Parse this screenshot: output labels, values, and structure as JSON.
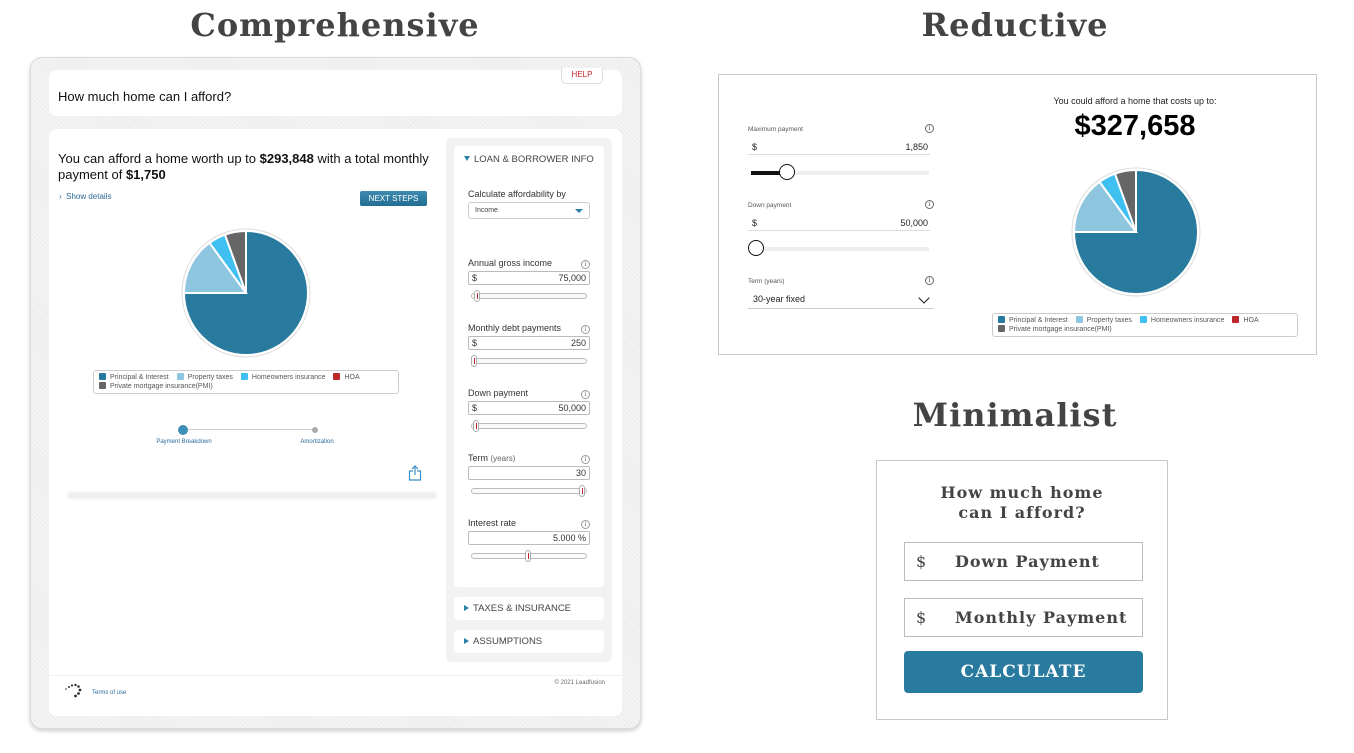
{
  "titles": {
    "comprehensive": "Comprehensive",
    "reductive": "Reductive",
    "minimalist": "Minimalist"
  },
  "colors": {
    "principal": "#287b9e",
    "taxes": "#8ec6e0",
    "homeowners": "#3fc0f0",
    "hoa": "#c0272d",
    "pmi": "#666666",
    "accent": "#287b9e"
  },
  "pie_shares": [
    {
      "key": "principal",
      "percent": 75
    },
    {
      "key": "taxes",
      "percent": 15
    },
    {
      "key": "homeowners",
      "percent": 4.5
    },
    {
      "key": "hoa",
      "percent": 0
    },
    {
      "key": "pmi",
      "percent": 5.5
    }
  ],
  "legend": [
    {
      "key": "principal",
      "label": "Principal & Interest"
    },
    {
      "key": "taxes",
      "label": "Property taxes"
    },
    {
      "key": "homeowners",
      "label": "Homeowners insurance"
    },
    {
      "key": "hoa",
      "label": "HOA"
    },
    {
      "key": "pmi",
      "label": "Private mortgage insurance(PMI)"
    }
  ],
  "comprehensive": {
    "question": "How much home can I afford?",
    "help": "HELP",
    "afford_prefix": "You can afford a home worth up to ",
    "afford_amount": "$293,848",
    "afford_mid": " with a total monthly payment of ",
    "afford_payment": "$1,750",
    "show_details": "Show details",
    "next_steps": "NEXT STEPS",
    "stepper": [
      "Payment Breakdown",
      "Amortization"
    ],
    "terms": "Terms of use",
    "copyright": "© 2021 Leadfusion",
    "side": {
      "loan_header": "LOAN & BORROWER INFO",
      "calc_by_label": "Calculate affordability by",
      "calc_by_value": "Income",
      "fields": [
        {
          "label": "Annual gross income",
          "sub": "",
          "currency": "$",
          "value": "75,000",
          "slider": 0.03
        },
        {
          "label": "Monthly debt payments",
          "sub": "",
          "currency": "$",
          "value": "250",
          "slider": 0.0
        },
        {
          "label": "Down payment",
          "sub": "",
          "currency": "$",
          "value": "50,000",
          "slider": 0.02
        },
        {
          "label": "Term",
          "sub": "(years)",
          "currency": "",
          "value": "30",
          "slider": 1.0
        },
        {
          "label": "Interest rate",
          "sub": "",
          "currency": "",
          "value": "5.000 %",
          "slider": 0.5
        }
      ],
      "taxes_header": "TAXES & INSURANCE",
      "assumptions_header": "ASSUMPTIONS"
    }
  },
  "reductive": {
    "max_payment_label": "Maximum payment",
    "max_payment_currency": "$",
    "max_payment_value": "1,850",
    "max_payment_slider": 0.2,
    "down_payment_label": "Down payment",
    "down_payment_currency": "$",
    "down_payment_value": "50,000",
    "down_payment_slider": 0.03,
    "term_label": "Term (years)",
    "term_value": "30-year fixed",
    "headline": "You could afford a home that costs up to:",
    "amount": "$327,658"
  },
  "minimalist": {
    "question_line1": "How much home",
    "question_line2": "can I afford?",
    "down_payment_currency": "$",
    "down_payment_placeholder": "Down Payment",
    "monthly_payment_currency": "$",
    "monthly_payment_placeholder": "Monthly Payment",
    "calculate": "CALCULATE"
  }
}
